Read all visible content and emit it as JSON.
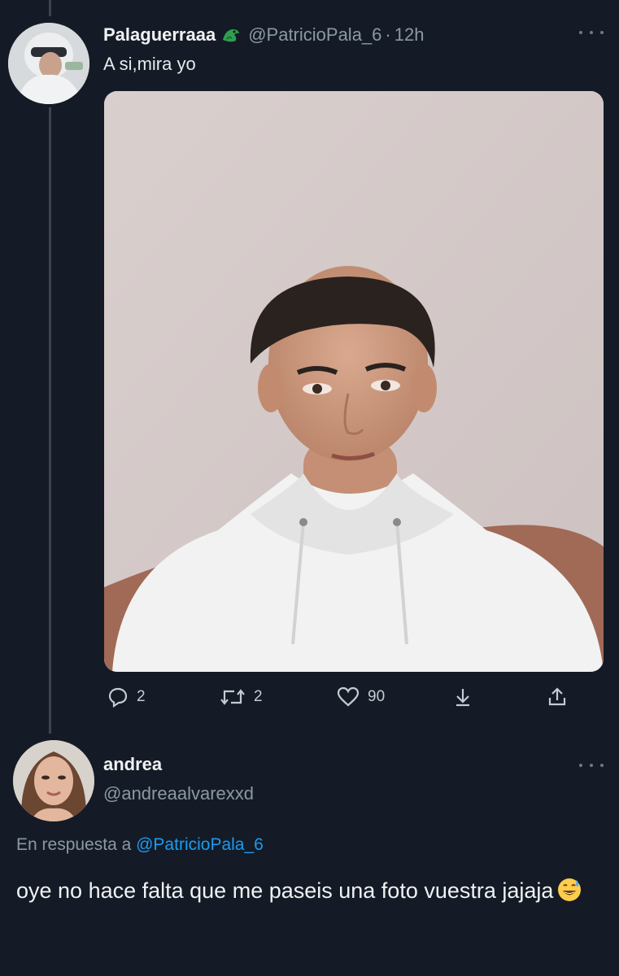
{
  "tweet": {
    "display_name": "Palaguerraaa",
    "badge_icon": "dragon-emoji-icon",
    "handle": "@PatricioPala_6",
    "separator": "·",
    "time": "12h",
    "text": "A si,mira yo",
    "media_description": "photo",
    "actions": {
      "reply_count": "2",
      "retweet_count": "2",
      "like_count": "90"
    }
  },
  "reply": {
    "display_name": "andrea",
    "handle": "@andreaalvarexxd",
    "replying_to_prefix": "En respuesta a",
    "replying_to_handle": "@PatricioPala_6",
    "text": "oye no hace falta que me paseis una foto vuestra jajaja",
    "emoji_icon": "grinning-sweat-emoji-icon"
  },
  "colors": {
    "background": "#141b26",
    "link": "#1d9bf0",
    "muted": "#8b98a5",
    "text": "#e7e9ea"
  }
}
